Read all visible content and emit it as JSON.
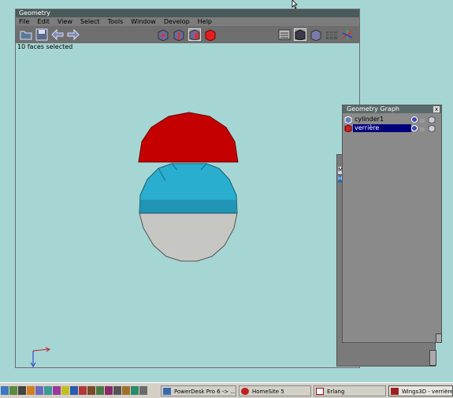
{
  "geometry_window": {
    "title": "Geometry",
    "menu": [
      "File",
      "Edit",
      "View",
      "Select",
      "Tools",
      "Window",
      "Develop",
      "Help"
    ],
    "status": "10 faces selected",
    "toolbar_left": [
      "open-icon",
      "save-icon",
      "undo-icon",
      "redo-icon"
    ],
    "select_modes": [
      "vertex-mode-icon",
      "edge-mode-icon",
      "face-mode-icon",
      "body-mode-icon"
    ],
    "view_modes": [
      "workmode-icon",
      "smooth-shade-icon",
      "flat-shade-icon",
      "wireframe-icon",
      "axes-icon"
    ]
  },
  "graph_window": {
    "title": "Geometry Graph",
    "close": "x",
    "objects": [
      {
        "name": "cylinder1",
        "selected": false
      },
      {
        "name": "verrière",
        "selected": true
      }
    ]
  },
  "behind_panel": {
    "letters": [
      "M",
      "H"
    ]
  },
  "taskbar": {
    "tasks": [
      {
        "label": "PowerDesk Pro 6 -> ...",
        "active": false
      },
      {
        "label": "HomeSite 5",
        "active": false
      },
      {
        "label": "Erlang",
        "active": false
      },
      {
        "label": "Wings3D - verrière.wi..",
        "active": true
      }
    ]
  },
  "colors": {
    "background": "#a6d6d4",
    "dome": "#c40000",
    "sphere_top": "#2aaed0",
    "sphere_bottom": "#c8c8c4",
    "selection": "#00007c"
  }
}
